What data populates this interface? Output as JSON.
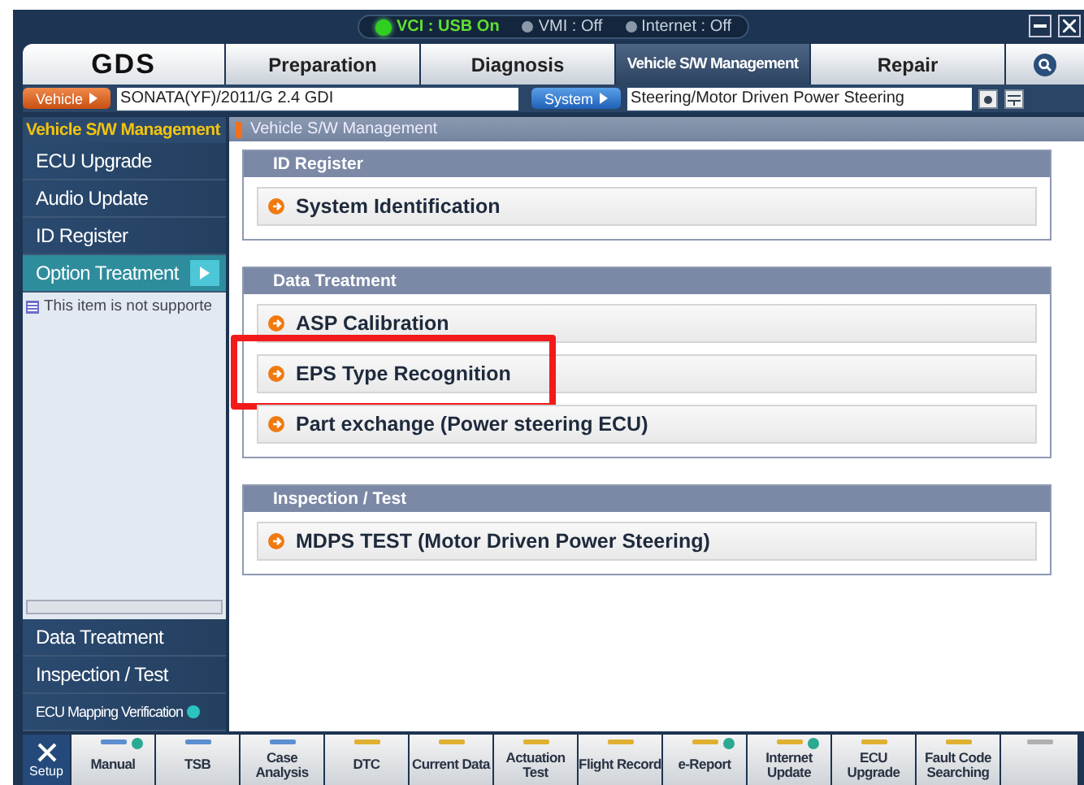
{
  "status": [
    {
      "label": "VCI : USB On",
      "on": true
    },
    {
      "label": "VMI : Off",
      "on": false
    },
    {
      "label": "Internet : Off",
      "on": false
    }
  ],
  "logo": "GDS",
  "tabs": [
    {
      "label": "Preparation",
      "selected": false
    },
    {
      "label": "Diagnosis",
      "selected": false
    },
    {
      "label": "Vehicle S/W Management",
      "selected": true
    },
    {
      "label": "Repair",
      "selected": false
    }
  ],
  "vehicle": {
    "button": "Vehicle",
    "value": "SONATA(YF)/2011/G 2.4 GDI"
  },
  "system": {
    "button": "System",
    "value": "Steering/Motor Driven Power Steering"
  },
  "sidebar": {
    "title": "Vehicle S/W Management",
    "items": [
      {
        "label": "ECU Upgrade",
        "selected": false
      },
      {
        "label": "Audio Update",
        "selected": false
      },
      {
        "label": "ID Register",
        "selected": false
      },
      {
        "label": "Option Treatment",
        "selected": true
      }
    ],
    "note": "This item is not supporte",
    "bottom_items": [
      {
        "label": "Data Treatment",
        "info": false
      },
      {
        "label": "Inspection / Test",
        "info": false
      },
      {
        "label": "ECU Mapping Verification",
        "info": true
      }
    ]
  },
  "main": {
    "title": "Vehicle S/W Management",
    "sections": [
      {
        "title": "ID Register",
        "items": [
          {
            "label": "System Identification",
            "highlighted": false
          }
        ]
      },
      {
        "title": "Data Treatment",
        "items": [
          {
            "label": "ASP Calibration",
            "highlighted": false
          },
          {
            "label": "EPS Type Recognition",
            "highlighted": true
          },
          {
            "label": "Part exchange (Power steering ECU)",
            "highlighted": false
          }
        ]
      },
      {
        "title": "Inspection / Test",
        "items": [
          {
            "label": "MDPS TEST (Motor Driven Power Steering)",
            "highlighted": false
          }
        ]
      }
    ]
  },
  "toolbar": {
    "setup": "Setup",
    "buttons": [
      {
        "label": "Manual",
        "color": "#5b8fd0",
        "info": true
      },
      {
        "label": "TSB",
        "color": "#5b8fd0",
        "info": false
      },
      {
        "label": "Case Analysis",
        "color": "#5b8fd0",
        "info": false
      },
      {
        "label": "DTC",
        "color": "#e0b030",
        "info": false
      },
      {
        "label": "Current Data",
        "color": "#e0b030",
        "info": false
      },
      {
        "label": "Actuation Test",
        "color": "#e0b030",
        "info": false
      },
      {
        "label": "Flight Record",
        "color": "#e0b030",
        "info": false
      },
      {
        "label": "e-Report",
        "color": "#e0b030",
        "info": true
      },
      {
        "label": "Internet Update",
        "color": "#e0b030",
        "info": true
      },
      {
        "label": "ECU Upgrade",
        "color": "#e0b030",
        "info": false
      },
      {
        "label": "Fault Code Searching",
        "color": "#e0b030",
        "info": false
      },
      {
        "color": "#b0b0b0"
      }
    ]
  }
}
